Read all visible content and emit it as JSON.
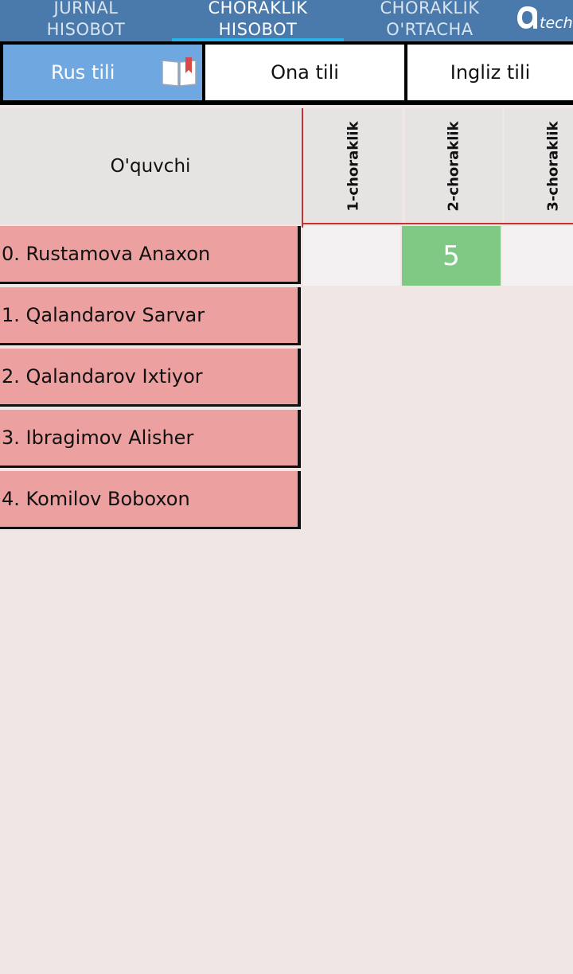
{
  "tabs": [
    {
      "line1": "JURNAL",
      "line2": "HISOBOT"
    },
    {
      "line1": "CHORAKLIK",
      "line2": "HISOBOT"
    },
    {
      "line1": "CHORAKLIK",
      "line2": "O'RTACHA"
    }
  ],
  "logo": {
    "text": "tech"
  },
  "subjects": [
    "Rus tili",
    "Ona tili",
    "Ingliz tili"
  ],
  "table": {
    "student_header": "O'quvchi",
    "columns": [
      "1-choraklik",
      "2-choraklik",
      "3-choraklik"
    ],
    "rows": [
      {
        "name": "0. Rustamova Anaxon",
        "grades": [
          "",
          "5",
          ""
        ]
      },
      {
        "name": "1. Qalandarov Sarvar"
      },
      {
        "name": "2. Qalandarov Ixtiyor"
      },
      {
        "name": "3. Ibragimov Alisher"
      },
      {
        "name": "4. Komilov Boboxon"
      }
    ]
  },
  "colors": {
    "topbar": "#4a7aab",
    "selected_subject": "#6fa7e0",
    "student_row": "#eca0a0",
    "grade_filled": "#80c985",
    "background": "#f0e6e6"
  }
}
